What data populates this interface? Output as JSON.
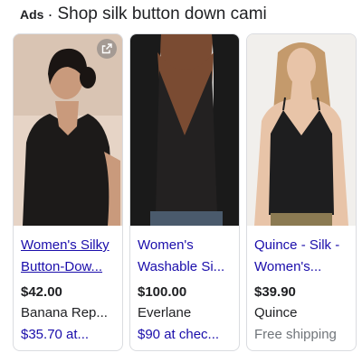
{
  "header": {
    "ads_label": "Ads",
    "separator": "·",
    "heading": "Shop silk button down cami"
  },
  "colors": {
    "link": "#1a0dab",
    "text": "#202124",
    "muted": "#70757a",
    "border": "#dadce0"
  },
  "products": [
    {
      "title_line1": "Women's Silky",
      "title_line2": "Button-Dow...",
      "price": "$42.00",
      "merchant": "Banana Rep...",
      "promo": "$35.70 at...",
      "icon": "external-link-icon"
    },
    {
      "title_line1": "Women's",
      "title_line2": "Washable Si...",
      "price": "$100.00",
      "merchant": "Everlane",
      "promo": "$90 at chec..."
    },
    {
      "title_line1": "Quince - Silk -",
      "title_line2": "Women's...",
      "price": "$39.90",
      "merchant": "Quince",
      "promo": "Free shipping"
    }
  ]
}
